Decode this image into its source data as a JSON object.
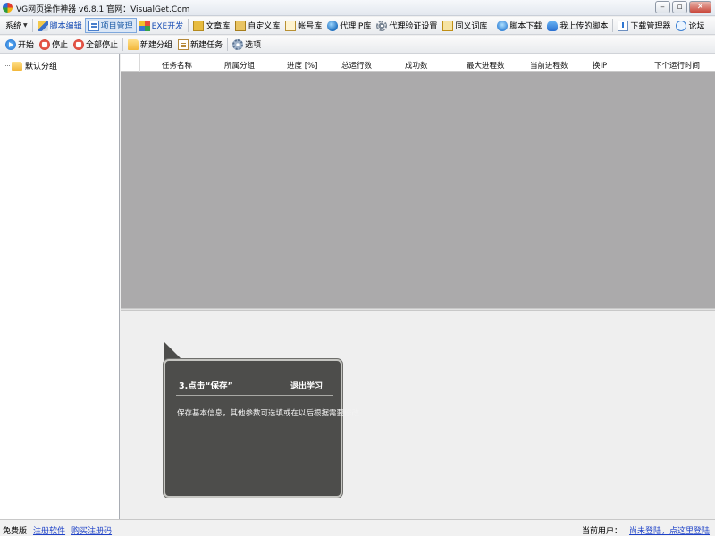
{
  "window": {
    "title": "VG网页操作神器 v6.8.1   官网：VisualGet.Com",
    "icon": "app-logo-icon",
    "controls": [
      "minimize",
      "restore",
      "close"
    ]
  },
  "toolbar_main": {
    "items": [
      {
        "label": "系统",
        "icon": "",
        "dropdown": true
      },
      {
        "label": "脚本编辑",
        "icon": "pen-icon",
        "style": "blue"
      },
      {
        "label": "项目管理",
        "icon": "project-icon",
        "active": true
      },
      {
        "label": "EXE开发",
        "icon": "grid-icon",
        "style": "blue"
      },
      {
        "label": "文章库",
        "icon": "book-icon"
      },
      {
        "label": "自定义库",
        "icon": "book-icon"
      },
      {
        "label": "帐号库",
        "icon": "id-card-icon"
      },
      {
        "label": "代理IP库",
        "icon": "globe-icon"
      },
      {
        "label": "代理验证设置",
        "icon": "gear-icon"
      },
      {
        "label": "同义词库",
        "icon": "dictionary-icon"
      },
      {
        "label": "脚本下载",
        "icon": "download-globe-icon"
      },
      {
        "label": "我上传的脚本",
        "icon": "upload-icon"
      },
      {
        "label": "下载管理器",
        "icon": "download-manager-icon"
      },
      {
        "label": "论坛",
        "icon": "forum-bubble-icon"
      }
    ]
  },
  "toolbar_tasks": {
    "items": [
      {
        "label": "开始",
        "icon": "play-icon"
      },
      {
        "label": "停止",
        "icon": "stop-icon"
      },
      {
        "label": "全部停止",
        "icon": "stop-all-icon"
      },
      {
        "label": "新建分组",
        "icon": "folder-icon"
      },
      {
        "label": "新建任务",
        "icon": "task-icon"
      },
      {
        "label": "选项",
        "icon": "options-icon"
      }
    ]
  },
  "tree": {
    "items": [
      {
        "label": "默认分组",
        "icon": "folder-icon"
      }
    ]
  },
  "table": {
    "columns": [
      "任务名称",
      "所属分组",
      "进度 [%]",
      "总运行数",
      "成功数",
      "最大进程数",
      "当前进程数",
      "换IP",
      "下个运行时间"
    ],
    "rows": []
  },
  "tutorial": {
    "title": "3.点击“保存”",
    "exit_label": "退出学习",
    "body": "保存基本信息，其他参数可选填或在以后根据需要修改"
  },
  "status": {
    "edition": "免费版",
    "register_link": "注册软件",
    "buy_link": "购买注册码",
    "user_label": "当前用户：",
    "login_link": "尚未登陆，点这里登陆"
  },
  "colors": {
    "grid_background": "#abaaab",
    "callout_background": "#4d4d4b",
    "link": "#1f43c8",
    "active_tab_border": "#7fa8dc"
  }
}
